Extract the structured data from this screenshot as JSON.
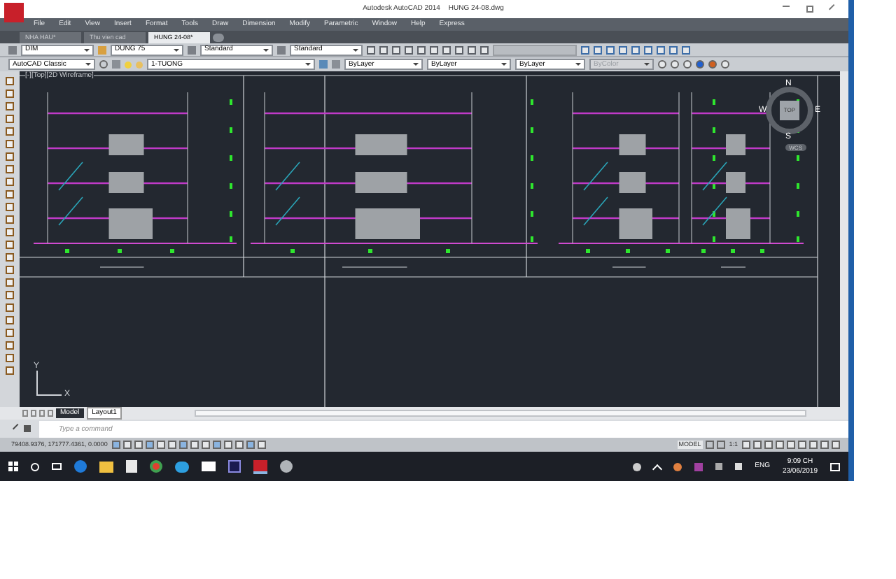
{
  "window": {
    "title": "Autodesk AutoCAD 2014",
    "filename": "HUNG 24-08.dwg"
  },
  "menu": [
    "File",
    "Edit",
    "View",
    "Insert",
    "Format",
    "Tools",
    "Draw",
    "Dimension",
    "Modify",
    "Parametric",
    "Window",
    "Help",
    "Express"
  ],
  "file_tabs": [
    {
      "label": "NHA HAU*",
      "selected": false
    },
    {
      "label": "Thu vien cad",
      "selected": false
    },
    {
      "label": "HUNG 24-08*",
      "selected": true
    }
  ],
  "toolbar_rows": [
    {
      "dropdowns": [
        {
          "value": "DIM",
          "disabled": false
        },
        {
          "value": "DUNG 75",
          "disabled": false
        },
        {
          "value": "Standard",
          "disabled": false
        },
        {
          "value": "Standard",
          "disabled": false
        }
      ]
    },
    {
      "dropdowns": [
        {
          "value": "AutoCAD Classic",
          "disabled": false
        },
        {
          "value": "1-TUONG",
          "disabled": false
        },
        {
          "value": "ByLayer",
          "disabled": false
        },
        {
          "value": "ByLayer",
          "disabled": false
        },
        {
          "value": "ByLayer",
          "disabled": false
        },
        {
          "value": "ByColor",
          "disabled": true
        }
      ]
    }
  ],
  "viewport": {
    "label": "[-][Top][2D Wireframe]",
    "compass": {
      "n": "N",
      "s": "S",
      "e": "E",
      "w": "W",
      "top": "TOP"
    },
    "ucs_button": "WCS",
    "ucs_axes": {
      "x": "X",
      "y": "Y"
    }
  },
  "layout_tabs": [
    {
      "label": "Model",
      "selected": true
    },
    {
      "label": "Layout1",
      "selected": false
    }
  ],
  "command_line": {
    "placeholder": "Type a command"
  },
  "status_bar": {
    "coordinates": "79408.9376, 171777.4361, 0.0000",
    "space": "MODEL",
    "scale": "1:1"
  },
  "taskbar": {
    "language": "ENG",
    "time": "9:09 CH",
    "date": "23/06/2019"
  }
}
